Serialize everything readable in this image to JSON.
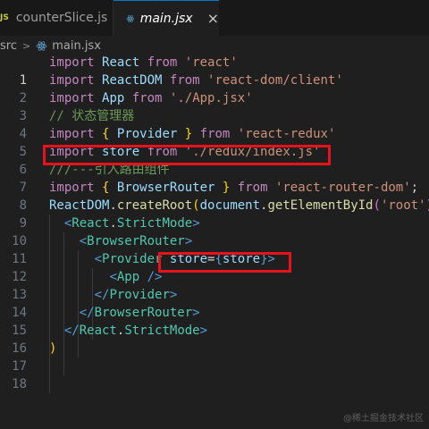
{
  "tabs": [
    {
      "icon": "JS",
      "label": "counterSlice.js",
      "active": false
    },
    {
      "icon": "react-icon",
      "label": "main.jsx",
      "active": true,
      "close": "×"
    }
  ],
  "breadcrumb": {
    "folder": "src",
    "separator": ">",
    "file": "main.jsx"
  },
  "editor": {
    "line_numbers": [
      "1",
      "2",
      "3",
      "4",
      "5",
      "6",
      "7",
      "8",
      "9",
      "10",
      "11",
      "12",
      "13",
      "14",
      "15",
      "16",
      "17",
      "18"
    ],
    "active_line": "1"
  },
  "watermark": "@稀土掘金技术社区",
  "colors": {
    "highlight_box": "#e8121c",
    "keyword": "#c586c0",
    "variable": "#9cdcfe",
    "string": "#ce9178",
    "comment": "#6a9955",
    "jsx_tag": "#569cd6"
  }
}
